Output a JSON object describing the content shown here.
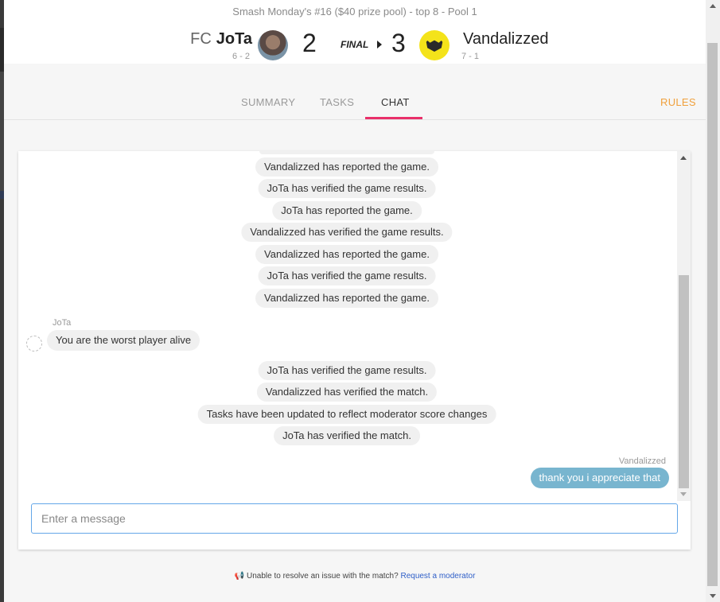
{
  "match": {
    "event_title": "Smash Monday's #16 ($40 prize pool) - top 8 - Pool 1",
    "status": "FINAL",
    "player1": {
      "prefix": "FC",
      "name": "JoTa",
      "record": "6 - 2",
      "score": "2"
    },
    "player2": {
      "name": "Vandalizzed",
      "record": "7 - 1",
      "score": "3"
    }
  },
  "tabs": {
    "summary": "SUMMARY",
    "tasks": "TASKS",
    "chat": "CHAT",
    "rules": "RULES",
    "active": "CHAT"
  },
  "chat": {
    "system_messages": [
      "Vandalizzed has reported the game.",
      "JoTa has verified the game results.",
      "JoTa has reported the game.",
      "Vandalizzed has verified the game results.",
      "Vandalizzed has reported the game.",
      "JoTa has verified the game results.",
      "Vandalizzed has reported the game.",
      "JoTa has verified the game results.",
      "Vandalizzed has verified the match.",
      "Tasks have been updated to reflect moderator score changes",
      "JoTa has verified the match."
    ],
    "jota_message": {
      "sender": "JoTa",
      "text": "You are the worst player alive"
    },
    "own_message": {
      "sender": "Vandalizzed",
      "text": "thank you i appreciate that"
    },
    "input_placeholder": "Enter a message"
  },
  "footer": {
    "text": "Unable to resolve an issue with the match?",
    "link": "Request a moderator"
  },
  "colors": {
    "accent_tab": "#e9306a",
    "rules": "#f0a03c",
    "own_bubble": "#78b5cf",
    "link": "#2f5fc8"
  },
  "icons": [
    "megaphone-icon",
    "scroll-up-icon",
    "scroll-down-icon",
    "winner-arrow-icon"
  ]
}
